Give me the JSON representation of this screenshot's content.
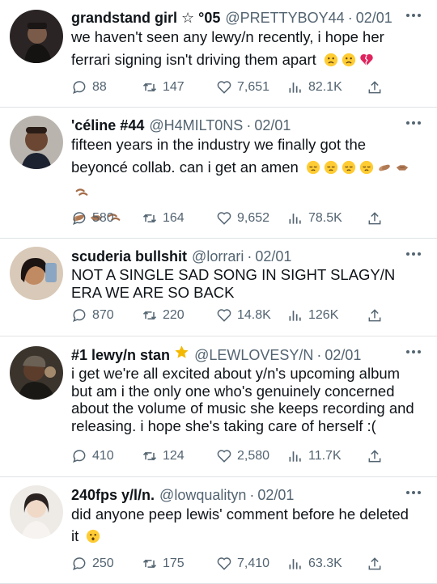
{
  "colors": {
    "text": "#0f1419",
    "secondary": "#536471",
    "divider": "#dfe3e6",
    "star_gold": "#f5b800"
  },
  "tweets": [
    {
      "name": "grandstand girl ☆ °05",
      "handle": "@PRETTYBOY44",
      "separator": "·",
      "date": "02/01",
      "text": "we haven't seen any lewy/n recently, i hope her ferrari signing isn't driving them apart",
      "emoji": [
        "worried-face",
        "worried-face",
        "broken-heart"
      ],
      "replies": "88",
      "retweets": "147",
      "likes": "7,651",
      "views": "82.1K"
    },
    {
      "name": "'céline #44",
      "handle": "@H4MILT0NS",
      "separator": "·",
      "date": "02/01",
      "text": "fifteen years in the industry we finally got the beyoncé collab. can i get an amen",
      "emoji": [
        "pensive-face",
        "pensive-face",
        "pensive-face",
        "pensive-face",
        "clapping-hands",
        "handshake",
        "bowing-hands",
        "clapping-hands",
        "handshake",
        "bowing-hands"
      ],
      "replies": "580",
      "retweets": "164",
      "likes": "9,652",
      "views": "78.5K"
    },
    {
      "name": "scuderia bullshit",
      "handle": "@lorrari",
      "separator": "·",
      "date": "02/01",
      "text": "NOT A SINGLE SAD SONG IN SIGHT SLAGY/N ERA WE ARE SO BACK",
      "emoji": [],
      "replies": "870",
      "retweets": "220",
      "likes": "14.8K",
      "views": "126K"
    },
    {
      "name": "#1 lewy/n stan",
      "name_icon": "star-icon",
      "handle": "@LEWLOVESY/N",
      "separator": "·",
      "date": "02/01",
      "text": "i get we're all excited about y/n's upcoming album but am i the only one who's genuinely concerned about the volume of music she keeps recording and releasing. i hope she's taking care of herself :(",
      "emoji": [],
      "replies": "410",
      "retweets": "124",
      "likes": "2,580",
      "views": "11.7K"
    },
    {
      "name": "240fps y/l/n.",
      "handle": "@lowqualityn",
      "separator": "·",
      "date": "02/01",
      "text": "did anyone peep lewis' comment before he deleted it",
      "emoji": [
        "hushed-face"
      ],
      "replies": "250",
      "retweets": "175",
      "likes": "7,410",
      "views": "63.3K"
    }
  ]
}
